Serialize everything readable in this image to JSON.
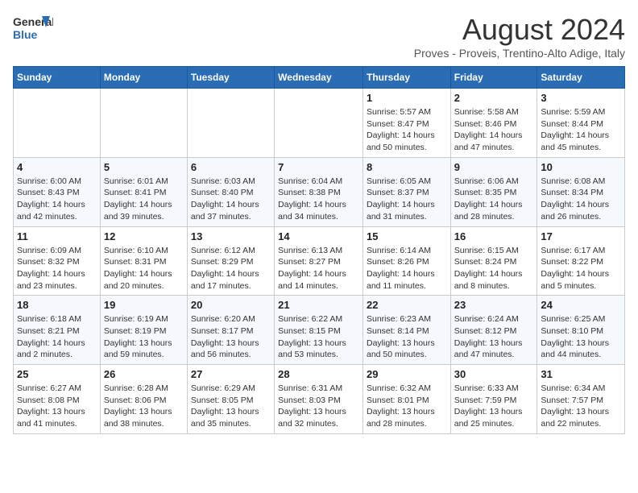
{
  "logo": {
    "line1": "General",
    "line2": "Blue"
  },
  "title": "August 2024",
  "subtitle": "Proves - Proveis, Trentino-Alto Adige, Italy",
  "weekdays": [
    "Sunday",
    "Monday",
    "Tuesday",
    "Wednesday",
    "Thursday",
    "Friday",
    "Saturday"
  ],
  "weeks": [
    [
      {
        "day": "",
        "info": ""
      },
      {
        "day": "",
        "info": ""
      },
      {
        "day": "",
        "info": ""
      },
      {
        "day": "",
        "info": ""
      },
      {
        "day": "1",
        "info": "Sunrise: 5:57 AM\nSunset: 8:47 PM\nDaylight: 14 hours and 50 minutes."
      },
      {
        "day": "2",
        "info": "Sunrise: 5:58 AM\nSunset: 8:46 PM\nDaylight: 14 hours and 47 minutes."
      },
      {
        "day": "3",
        "info": "Sunrise: 5:59 AM\nSunset: 8:44 PM\nDaylight: 14 hours and 45 minutes."
      }
    ],
    [
      {
        "day": "4",
        "info": "Sunrise: 6:00 AM\nSunset: 8:43 PM\nDaylight: 14 hours and 42 minutes."
      },
      {
        "day": "5",
        "info": "Sunrise: 6:01 AM\nSunset: 8:41 PM\nDaylight: 14 hours and 39 minutes."
      },
      {
        "day": "6",
        "info": "Sunrise: 6:03 AM\nSunset: 8:40 PM\nDaylight: 14 hours and 37 minutes."
      },
      {
        "day": "7",
        "info": "Sunrise: 6:04 AM\nSunset: 8:38 PM\nDaylight: 14 hours and 34 minutes."
      },
      {
        "day": "8",
        "info": "Sunrise: 6:05 AM\nSunset: 8:37 PM\nDaylight: 14 hours and 31 minutes."
      },
      {
        "day": "9",
        "info": "Sunrise: 6:06 AM\nSunset: 8:35 PM\nDaylight: 14 hours and 28 minutes."
      },
      {
        "day": "10",
        "info": "Sunrise: 6:08 AM\nSunset: 8:34 PM\nDaylight: 14 hours and 26 minutes."
      }
    ],
    [
      {
        "day": "11",
        "info": "Sunrise: 6:09 AM\nSunset: 8:32 PM\nDaylight: 14 hours and 23 minutes."
      },
      {
        "day": "12",
        "info": "Sunrise: 6:10 AM\nSunset: 8:31 PM\nDaylight: 14 hours and 20 minutes."
      },
      {
        "day": "13",
        "info": "Sunrise: 6:12 AM\nSunset: 8:29 PM\nDaylight: 14 hours and 17 minutes."
      },
      {
        "day": "14",
        "info": "Sunrise: 6:13 AM\nSunset: 8:27 PM\nDaylight: 14 hours and 14 minutes."
      },
      {
        "day": "15",
        "info": "Sunrise: 6:14 AM\nSunset: 8:26 PM\nDaylight: 14 hours and 11 minutes."
      },
      {
        "day": "16",
        "info": "Sunrise: 6:15 AM\nSunset: 8:24 PM\nDaylight: 14 hours and 8 minutes."
      },
      {
        "day": "17",
        "info": "Sunrise: 6:17 AM\nSunset: 8:22 PM\nDaylight: 14 hours and 5 minutes."
      }
    ],
    [
      {
        "day": "18",
        "info": "Sunrise: 6:18 AM\nSunset: 8:21 PM\nDaylight: 14 hours and 2 minutes."
      },
      {
        "day": "19",
        "info": "Sunrise: 6:19 AM\nSunset: 8:19 PM\nDaylight: 13 hours and 59 minutes."
      },
      {
        "day": "20",
        "info": "Sunrise: 6:20 AM\nSunset: 8:17 PM\nDaylight: 13 hours and 56 minutes."
      },
      {
        "day": "21",
        "info": "Sunrise: 6:22 AM\nSunset: 8:15 PM\nDaylight: 13 hours and 53 minutes."
      },
      {
        "day": "22",
        "info": "Sunrise: 6:23 AM\nSunset: 8:14 PM\nDaylight: 13 hours and 50 minutes."
      },
      {
        "day": "23",
        "info": "Sunrise: 6:24 AM\nSunset: 8:12 PM\nDaylight: 13 hours and 47 minutes."
      },
      {
        "day": "24",
        "info": "Sunrise: 6:25 AM\nSunset: 8:10 PM\nDaylight: 13 hours and 44 minutes."
      }
    ],
    [
      {
        "day": "25",
        "info": "Sunrise: 6:27 AM\nSunset: 8:08 PM\nDaylight: 13 hours and 41 minutes."
      },
      {
        "day": "26",
        "info": "Sunrise: 6:28 AM\nSunset: 8:06 PM\nDaylight: 13 hours and 38 minutes."
      },
      {
        "day": "27",
        "info": "Sunrise: 6:29 AM\nSunset: 8:05 PM\nDaylight: 13 hours and 35 minutes."
      },
      {
        "day": "28",
        "info": "Sunrise: 6:31 AM\nSunset: 8:03 PM\nDaylight: 13 hours and 32 minutes."
      },
      {
        "day": "29",
        "info": "Sunrise: 6:32 AM\nSunset: 8:01 PM\nDaylight: 13 hours and 28 minutes."
      },
      {
        "day": "30",
        "info": "Sunrise: 6:33 AM\nSunset: 7:59 PM\nDaylight: 13 hours and 25 minutes."
      },
      {
        "day": "31",
        "info": "Sunrise: 6:34 AM\nSunset: 7:57 PM\nDaylight: 13 hours and 22 minutes."
      }
    ]
  ]
}
